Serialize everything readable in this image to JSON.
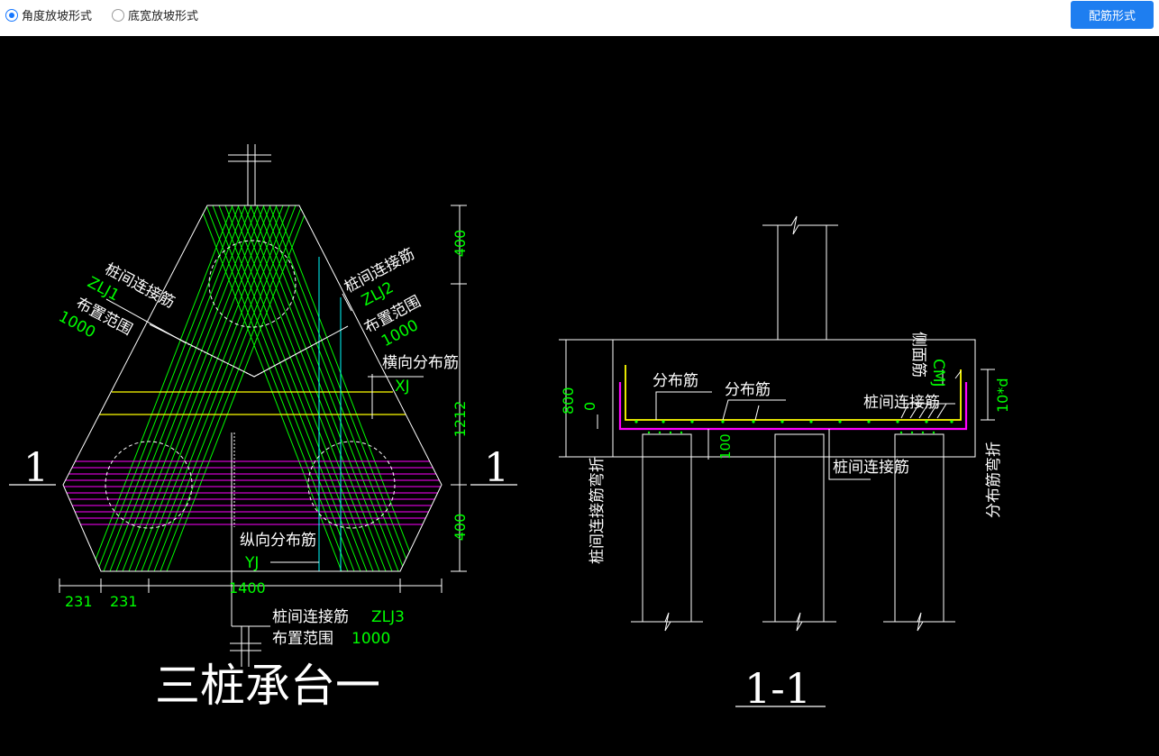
{
  "toolbar": {
    "radio_options": [
      "角度放坡形式",
      "底宽放坡形式"
    ],
    "selected_index": 0,
    "button_label": "配筋形式"
  },
  "colors": {
    "background": "#000000",
    "line": "#ffffff",
    "green": "#00ff00",
    "yellow": "#ffff00",
    "magenta": "#ff00ff",
    "cyan": "#00ffff",
    "button": "#1e7ef0"
  },
  "plan": {
    "title": "三桩承台一",
    "section_mark": "1",
    "zlj1": {
      "name": "桩间连接筋",
      "code": "ZLJ1",
      "range_label": "布置范围",
      "range": "1000"
    },
    "zlj2": {
      "name": "桩间连接筋",
      "code": "ZLJ2",
      "range_label": "布置范围",
      "range": "1000"
    },
    "zlj3": {
      "name": "桩间连接筋",
      "code": "ZLJ3",
      "range_label": "布置范围",
      "range": "1000"
    },
    "transverse": {
      "name": "横向分布筋",
      "code": "XJ"
    },
    "longitudinal": {
      "name": "纵向分布筋",
      "code": "YJ"
    },
    "dims": {
      "right": [
        "400",
        "1212",
        "400"
      ],
      "bottom": [
        "231",
        "231",
        "1400"
      ]
    }
  },
  "section": {
    "title": "1-1",
    "labels": {
      "dist1": "分布筋",
      "dist2": "分布筋",
      "side": "侧面筋",
      "side_code": "CMJ",
      "tie_top": "桩间连接筋",
      "tie_bottom": "桩间连接筋",
      "tie_bend": "桩间连接筋弯折",
      "dist_bend": "分布筋弯折",
      "dist_bend_len": "10*d"
    },
    "dims": {
      "height": "800",
      "cover": "0",
      "pile_embed": "100"
    }
  }
}
